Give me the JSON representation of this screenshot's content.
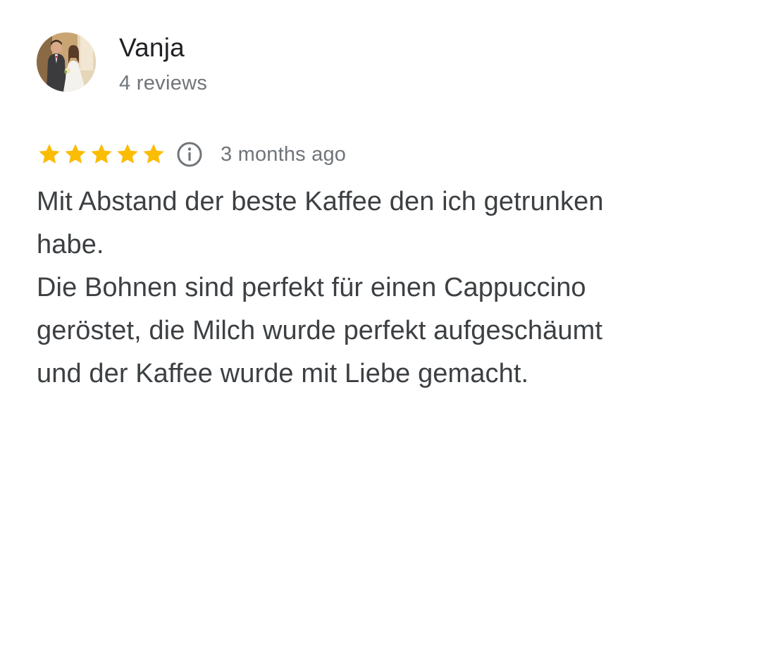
{
  "review": {
    "author": {
      "name": "Vanja",
      "meta": "4 reviews",
      "avatar_icon": "profile-photo"
    },
    "rating": {
      "stars": 5,
      "max_stars": 5,
      "star_color": "#fbbc04",
      "info_icon": "info-icon",
      "date": "3 months ago"
    },
    "text_lines": [
      "Mit Abstand der beste Kaffee den ich getrunken",
      "habe.",
      "Die Bohnen sind perfekt für einen Cappuccino",
      "geröstet, die Milch wurde perfekt aufgeschäumt",
      "und der Kaffee wurde mit Liebe gemacht."
    ]
  }
}
